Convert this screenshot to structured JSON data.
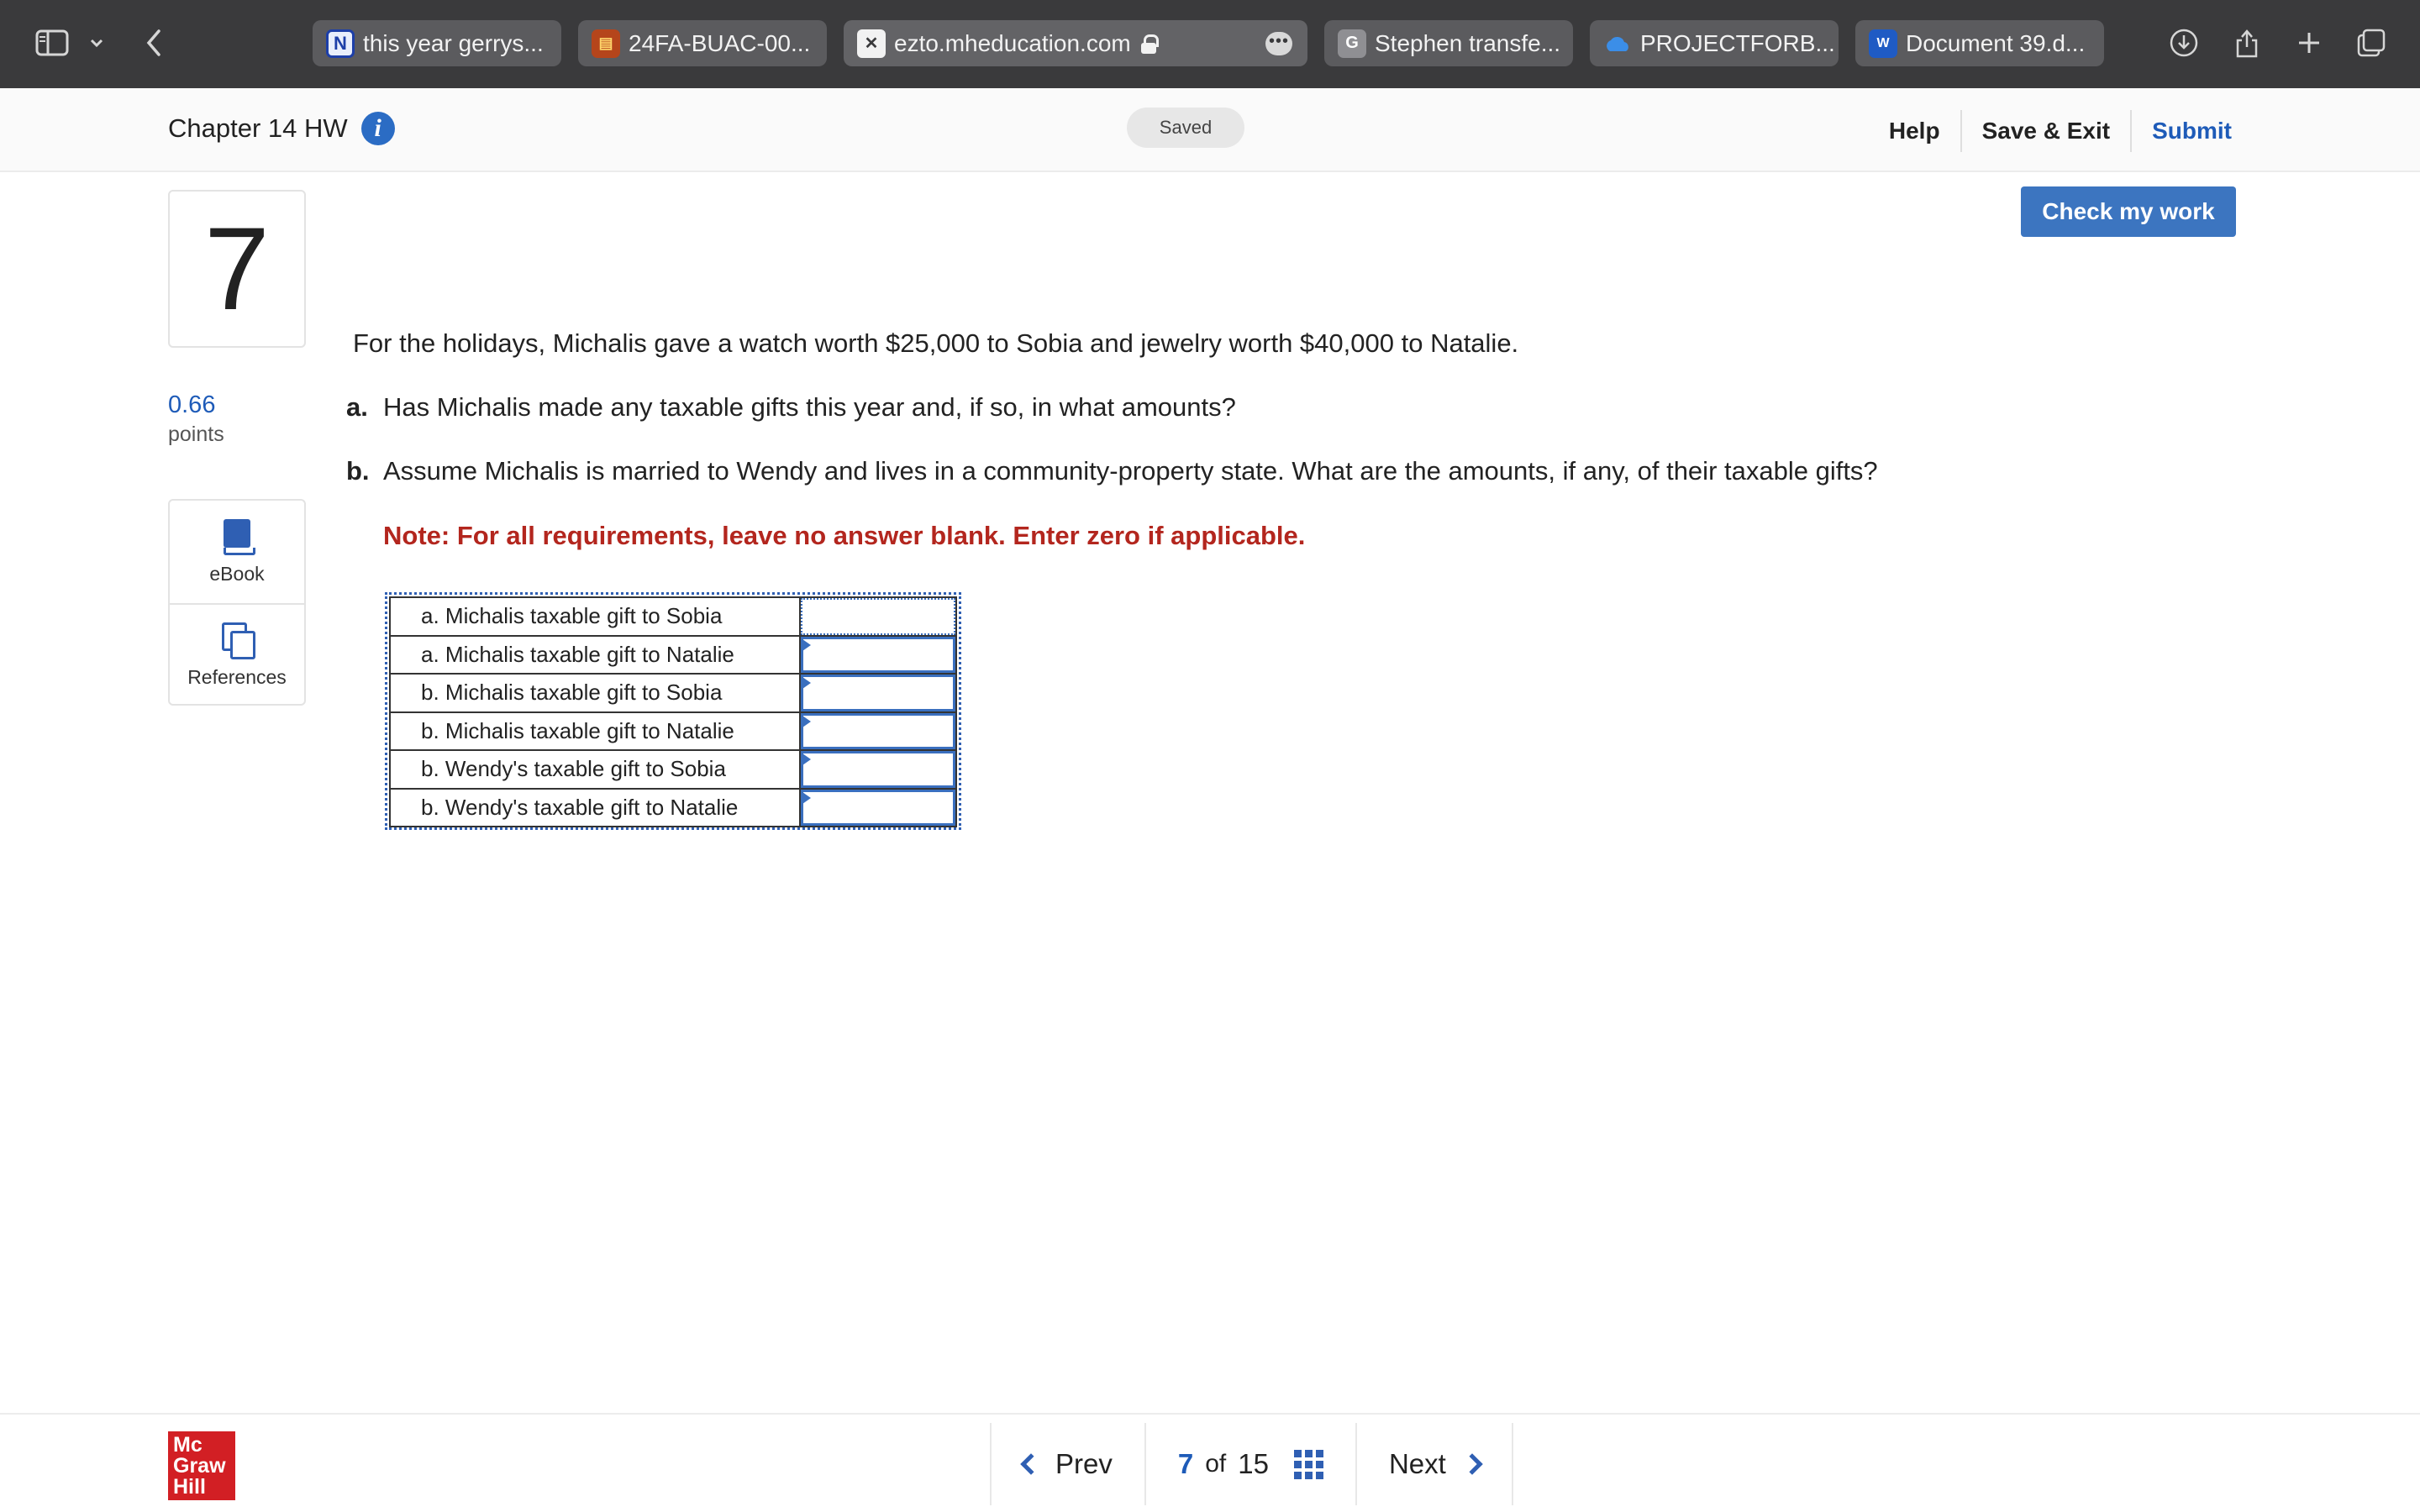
{
  "browser": {
    "tabs": [
      {
        "label": "this year gerrys...",
        "favicon": "N"
      },
      {
        "label": "24FA-BUAC-00...",
        "favicon": "book"
      },
      {
        "label": "ezto.mheducation.com",
        "favicon": "x",
        "active": true
      },
      {
        "label": "Stephen transfe...",
        "favicon": "G"
      },
      {
        "label": "PROJECTFORB...",
        "favicon": "onedrive"
      },
      {
        "label": "Document 39.d...",
        "favicon": "W"
      }
    ]
  },
  "header": {
    "title": "Chapter 14 HW",
    "info_icon": "i",
    "status": "Saved",
    "links": {
      "help": "Help",
      "save_exit": "Save & Exit",
      "submit": "Submit"
    }
  },
  "question": {
    "number": "7",
    "points_value": "0.66",
    "points_label": "points",
    "tools": {
      "ebook": "eBook",
      "references": "References"
    },
    "check_button": "Check my work",
    "prompt": "For the holidays, Michalis gave a watch worth $25,000 to Sobia and jewelry worth $40,000 to Natalie.",
    "parts": [
      {
        "letter": "a.",
        "text": "Has Michalis made any taxable gifts this year and, if so, in what amounts?"
      },
      {
        "letter": "b.",
        "text": "Assume Michalis is married to Wendy and lives in a community-property state. What are the amounts, if any, of their taxable gifts?"
      }
    ],
    "note": "Note: For all requirements, leave no answer blank. Enter zero if applicable.",
    "answers": [
      {
        "label": "a. Michalis taxable gift to Sobia",
        "value": ""
      },
      {
        "label": "a. Michalis taxable gift to Natalie",
        "value": ""
      },
      {
        "label": "b. Michalis taxable gift to Sobia",
        "value": ""
      },
      {
        "label": "b. Michalis taxable gift to Natalie",
        "value": ""
      },
      {
        "label": "b. Wendy's taxable gift to Sobia",
        "value": ""
      },
      {
        "label": "b. Wendy's taxable gift to Natalie",
        "value": ""
      }
    ]
  },
  "footer": {
    "logo_lines": [
      "Mc",
      "Graw",
      "Hill"
    ],
    "prev": "Prev",
    "current": "7",
    "of": "of",
    "total": "15",
    "next": "Next"
  },
  "colors": {
    "accent": "#2b6cc4",
    "note_red": "#b3261e",
    "logo_red": "#d21f24",
    "chrome": "#3a3a3c"
  }
}
